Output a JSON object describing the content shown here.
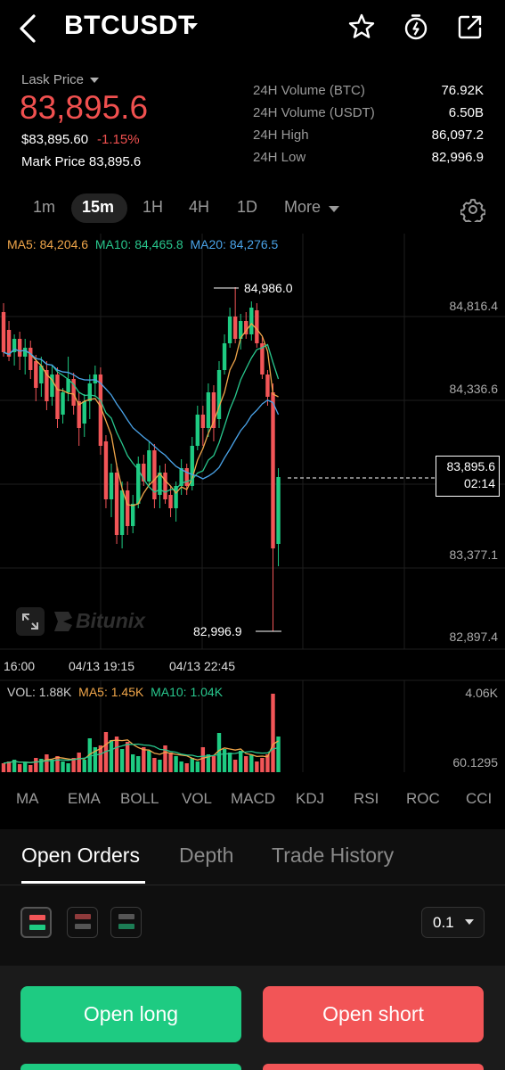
{
  "header": {
    "symbol": "BTCUSDT",
    "icons": [
      "back-icon",
      "star-icon",
      "stopwatch-icon",
      "share-icon"
    ]
  },
  "price": {
    "label": "Lask Price",
    "last": "83,895.6",
    "usd": "$83,895.60",
    "change": "-1.15%",
    "mark_label": "Mark Price",
    "mark_value": "83,895.6"
  },
  "stats": [
    {
      "label": "24H Volume (BTC)",
      "value": "76.92K"
    },
    {
      "label": "24H Volume (USDT)",
      "value": "6.50B"
    },
    {
      "label": "24H High",
      "value": "86,097.2"
    },
    {
      "label": "24H Low",
      "value": "82,996.9"
    }
  ],
  "intervals": [
    "1m",
    "15m",
    "1H",
    "4H",
    "1D",
    "More"
  ],
  "active_interval": "15m",
  "ma_legend": {
    "ma5": "MA5: 84,204.6",
    "ma10": "MA10: 84,465.8",
    "ma20": "MA20: 84,276.5"
  },
  "chart": {
    "price_axis": [
      "84,816.4",
      "84,336.6",
      "83,377.1",
      "82,897.4"
    ],
    "high_label": "84,986.0",
    "low_label": "82,996.9",
    "current_price": "83,895.6",
    "countdown": "02:14",
    "time_axis": [
      "16:00",
      "04/13 19:15",
      "04/13 22:45"
    ],
    "watermark": "Bitunix"
  },
  "volume_legend": {
    "vol": "VOL: 1.88K",
    "ma5": "MA5: 1.45K",
    "ma10": "MA10: 1.04K",
    "axis_top": "4.06K",
    "axis_bottom": "60.1295"
  },
  "indicators": [
    "MA",
    "EMA",
    "BOLL",
    "VOL",
    "MACD",
    "KDJ",
    "RSI",
    "ROC",
    "CCI"
  ],
  "active_indicators": [
    "MA",
    "VOL"
  ],
  "tabs": [
    "Open Orders",
    "Depth",
    "Trade History"
  ],
  "active_tab": "Open Orders",
  "precision": "0.1",
  "actions": {
    "long": "Open long",
    "short": "Open short"
  },
  "colors": {
    "up": "#1ecb82",
    "down": "#f25557",
    "ma5": "#f0a64a",
    "ma10": "#28c78d",
    "ma20": "#4aa3e8"
  }
}
